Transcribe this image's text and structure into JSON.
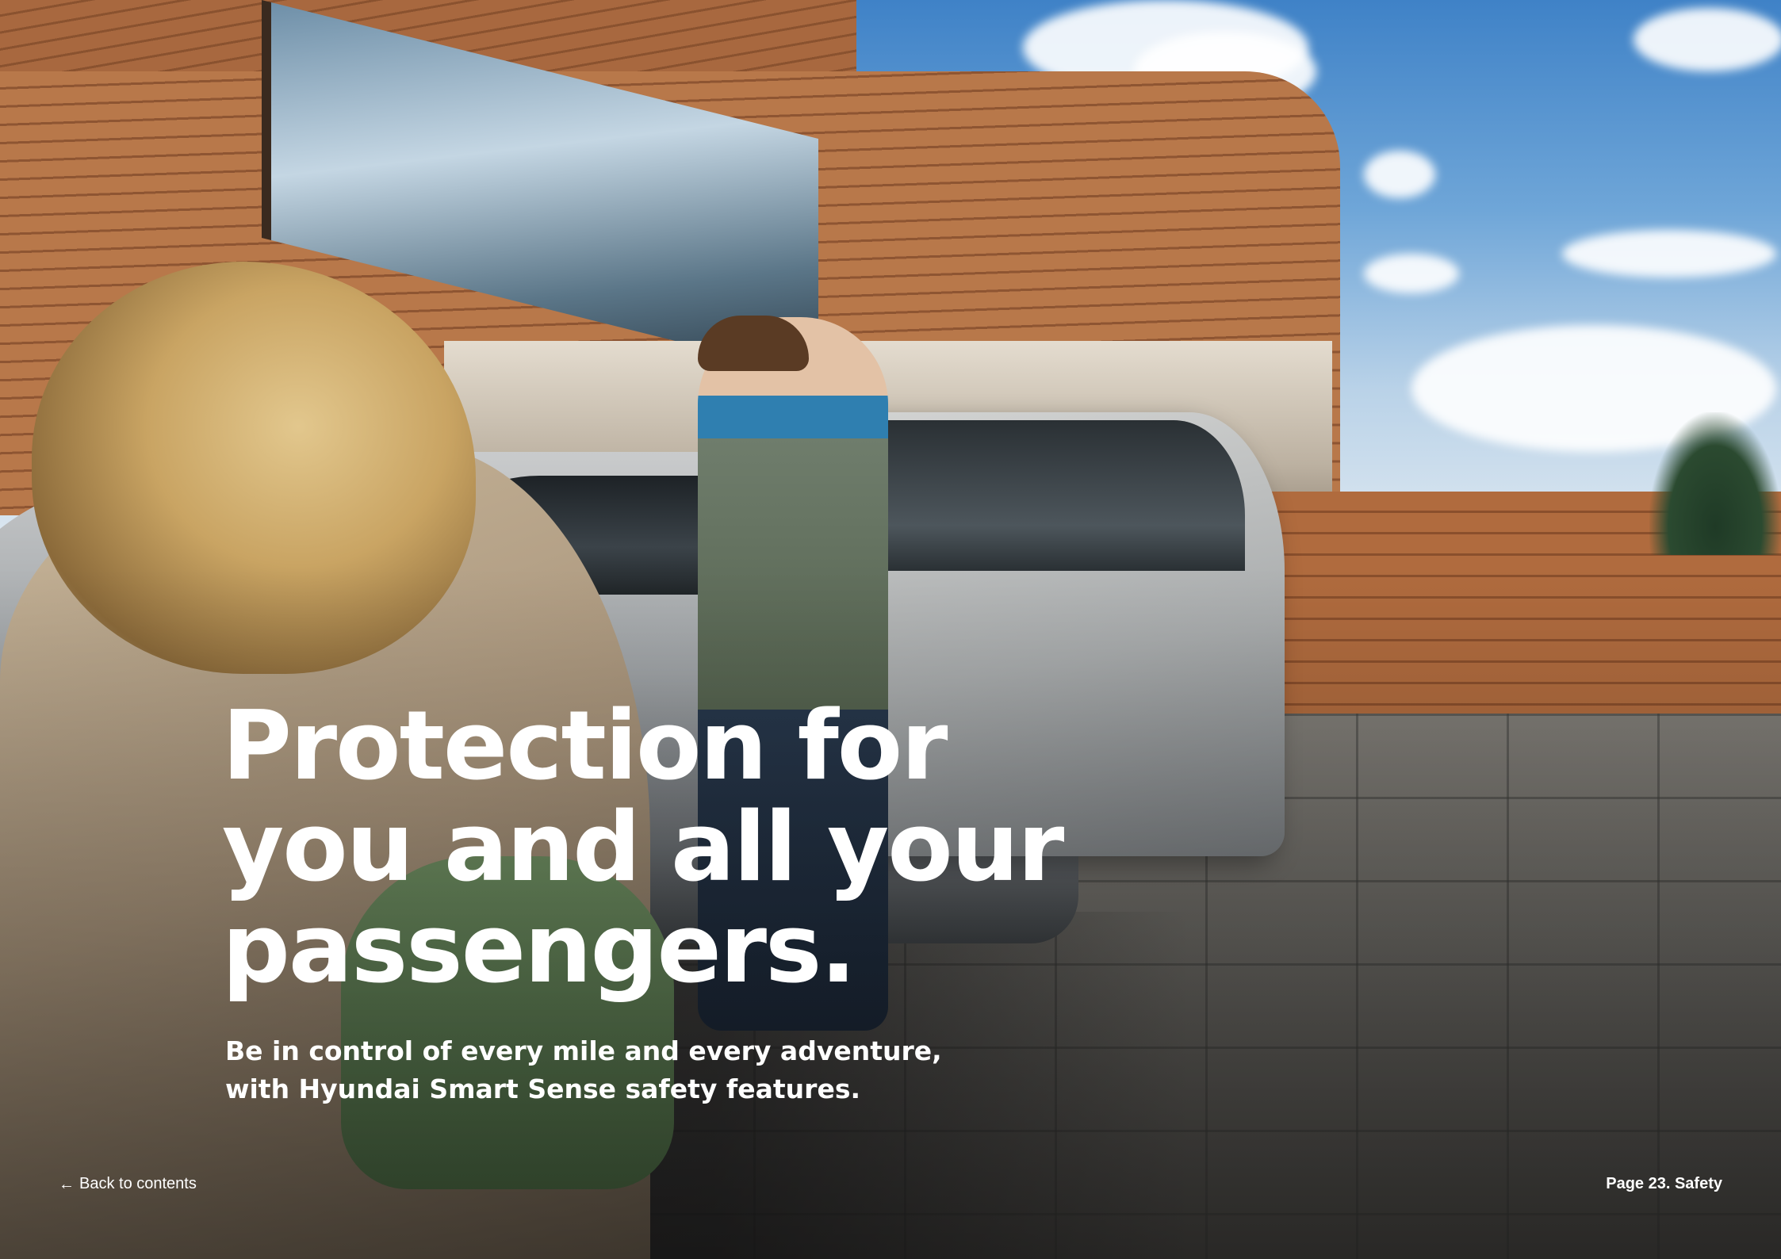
{
  "hero": {
    "headline_lines": [
      "Protection for",
      "you and all your",
      "passengers."
    ],
    "subhead_lines": [
      "Be in control of every mile and every adventure,",
      "with Hyundai Smart Sense safety features."
    ]
  },
  "footer": {
    "back_arrow_icon": "arrow-left-icon",
    "back_glyph": "←",
    "back_label": "Back to contents",
    "page_label": "Page 23. Safety"
  },
  "colors": {
    "text": "#ffffff"
  }
}
